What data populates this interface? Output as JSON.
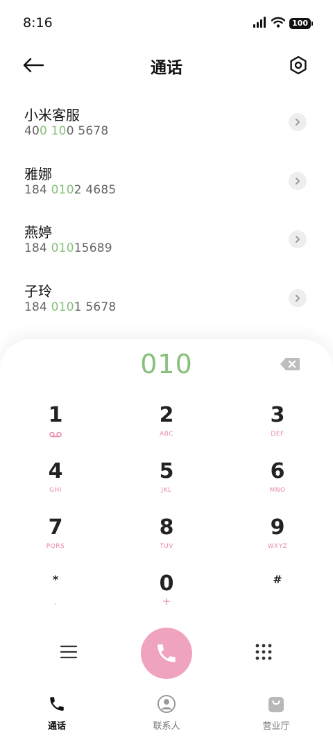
{
  "status_bar": {
    "time": "8:16",
    "battery": "100"
  },
  "header": {
    "title": "通话"
  },
  "contacts": [
    {
      "name": "小米客服",
      "number_parts": [
        "40",
        "0 10",
        "0 5678"
      ]
    },
    {
      "name": "雅娜",
      "number_parts": [
        "184 ",
        "010",
        "2 4685"
      ]
    },
    {
      "name": "燕婷",
      "number_parts": [
        "184 ",
        "010",
        "15689"
      ]
    },
    {
      "name": "子玲",
      "number_parts": [
        "184 ",
        "010",
        "1 5678"
      ]
    }
  ],
  "dialer": {
    "input": "010",
    "keys": [
      {
        "digit": "1",
        "letters": ""
      },
      {
        "digit": "2",
        "letters": "ABC"
      },
      {
        "digit": "3",
        "letters": "DEF"
      },
      {
        "digit": "4",
        "letters": "GHI"
      },
      {
        "digit": "5",
        "letters": "JKL"
      },
      {
        "digit": "6",
        "letters": "MNO"
      },
      {
        "digit": "7",
        "letters": "PQRS"
      },
      {
        "digit": "8",
        "letters": "TUV"
      },
      {
        "digit": "9",
        "letters": "WXYZ"
      },
      {
        "digit": "*",
        "letters": ","
      },
      {
        "digit": "0",
        "letters": "+"
      },
      {
        "digit": "#",
        "letters": ""
      }
    ]
  },
  "bottom_nav": {
    "items": [
      {
        "label": "通话",
        "icon": "phone-icon",
        "active": true
      },
      {
        "label": "联系人",
        "icon": "person-icon",
        "active": false
      },
      {
        "label": "营业厅",
        "icon": "shopping-bag-icon",
        "active": false
      }
    ]
  },
  "colors": {
    "highlight_green": "#86c07a",
    "accent_pink": "#f0a3bf",
    "letter_pink": "#e98aa9"
  }
}
